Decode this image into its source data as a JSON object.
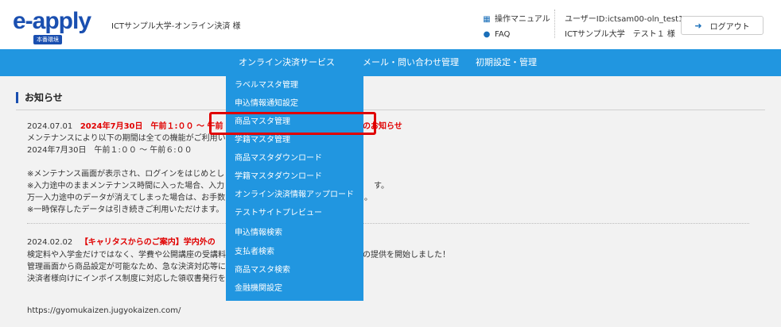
{
  "header": {
    "logo_text": "e-apply",
    "env_badge": "本番環境",
    "site_name": "ICTサンプル大学-オンライン決済 様",
    "help_links": [
      {
        "label": "操作マニュアル",
        "icon": "book-icon"
      },
      {
        "label": "FAQ",
        "icon": "chat-icon"
      }
    ],
    "user_id": "ユーザーID:ictsam00-oln_test1",
    "user_name": "ICTサンプル大学　テスト１ 様",
    "logout_label": "ログアウト"
  },
  "nav": {
    "items": [
      {
        "label": "オンライン決済サービス"
      },
      {
        "label": "メール・問い合わせ管理"
      },
      {
        "label": "初期設定・管理"
      }
    ]
  },
  "dropdown": {
    "items": [
      {
        "label": "ラベルマスタ管理"
      },
      {
        "label": "申込情報通知設定"
      },
      {
        "label": "商品マスタ管理"
      },
      {
        "label": "学籍マスタ管理"
      },
      {
        "label": "商品マスタダウンロード"
      },
      {
        "label": "学籍マスタダウンロード"
      },
      {
        "label": "オンライン決済情報アップロード"
      },
      {
        "label": "テストサイトプレビュー"
      },
      {
        "label": "申込情報検索"
      },
      {
        "label": "支払者検索"
      },
      {
        "label": "商品マスタ検索"
      },
      {
        "label": "金融機関設定"
      }
    ],
    "highlighted_index": 2,
    "highlight_color": "#e00000"
  },
  "main": {
    "section_title": "お知らせ",
    "news": [
      {
        "date": "2024.07.01",
        "title_left": "2024年7月30日　午前１:００ ～ 午前",
        "title_right": "のお知らせ",
        "lines": [
          {
            "left": "メンテナンスにより以下の期間は全ての機能がご利用い",
            "right": ""
          },
          {
            "left": "2024年7月30日　午前１:００ ～ 午前６:００",
            "right": ""
          },
          {
            "left": "",
            "right": ""
          },
          {
            "left": "※メンテナンス画面が表示され、ログインをはじめとし",
            "right": ""
          },
          {
            "left": "※入力途中のままメンテナンス時間に入った場合、入力",
            "right": "す。"
          },
          {
            "left": "万一入力途中のデータが消えてしまった場合は、お手数",
            "right": "。"
          },
          {
            "left": "※一時保存したデータは引き続きご利用いただけます。",
            "right": ""
          }
        ]
      },
      {
        "date": "2024.02.02",
        "title_left": "【キャリタスからのご案内】学内外の",
        "title_right": "",
        "lines": [
          {
            "left": "検定料や入学金だけではなく、学費や公開講座の受講料",
            "right": "の提供を開始しました！"
          },
          {
            "left": "管理画面から商品設定が可能なため、急な決済対応等に",
            "right": ""
          },
          {
            "left": "決済者様向けにインボイス制度に対応した領収書発行を",
            "right": ""
          },
          {
            "left": "",
            "right": ""
          },
          {
            "left": "https://gyomukaizen.jugyokaizen.com/",
            "right": ""
          }
        ]
      }
    ]
  },
  "colors": {
    "brand": "#1a4fb0",
    "nav_bg": "#2196e0",
    "alert_red": "#e00000",
    "content_bg": "#f2f2f2"
  }
}
